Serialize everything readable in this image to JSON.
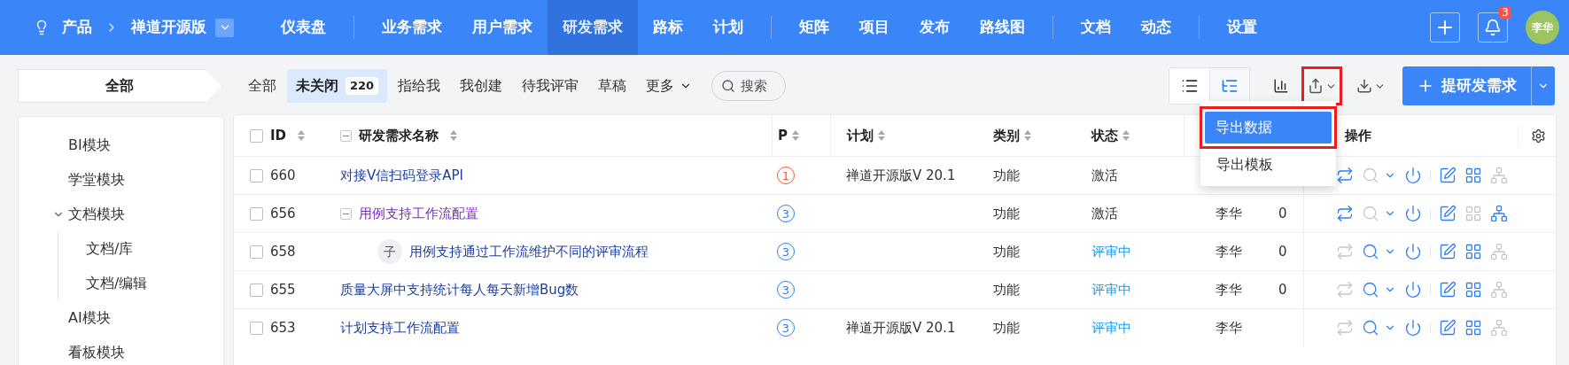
{
  "topbar": {
    "breadcrumb": [
      "产品",
      "禅道开源版"
    ],
    "nav": [
      {
        "label": "仪表盘",
        "selected": false,
        "group_end": true
      },
      {
        "label": "业务需求",
        "selected": false
      },
      {
        "label": "用户需求",
        "selected": false
      },
      {
        "label": "研发需求",
        "selected": true
      },
      {
        "label": "路标",
        "selected": false
      },
      {
        "label": "计划",
        "selected": false,
        "group_end": true
      },
      {
        "label": "矩阵",
        "selected": false
      },
      {
        "label": "项目",
        "selected": false
      },
      {
        "label": "发布",
        "selected": false
      },
      {
        "label": "路线图",
        "selected": false,
        "group_end": true
      },
      {
        "label": "文档",
        "selected": false
      },
      {
        "label": "动态",
        "selected": false,
        "group_end": true
      },
      {
        "label": "设置",
        "selected": false
      }
    ],
    "notification_count": "3",
    "avatar": "李华"
  },
  "filterbar": {
    "module": "全部",
    "tabs": [
      {
        "label": "全部",
        "selected": false
      },
      {
        "label": "未关闭",
        "count": "220",
        "selected": true
      },
      {
        "label": "指给我",
        "selected": false
      },
      {
        "label": "我创建",
        "selected": false
      },
      {
        "label": "待我评审",
        "selected": false
      },
      {
        "label": "草稿",
        "selected": false
      }
    ],
    "more": "更多",
    "search": {
      "placeholder": "搜索"
    },
    "views": [
      {
        "kind": "list",
        "selected": false
      },
      {
        "kind": "tree",
        "selected": true
      }
    ],
    "export_highlighted": true,
    "create_button": "提研发需求"
  },
  "sidebar": {
    "items": [
      {
        "label": "BI模块"
      },
      {
        "label": "学堂模块"
      },
      {
        "label": "文档模块",
        "expanded": true,
        "children": [
          {
            "label": "文档/库"
          },
          {
            "label": "文档/编辑"
          }
        ]
      },
      {
        "label": "AI模块"
      },
      {
        "label": "看板模块"
      }
    ]
  },
  "table": {
    "all_checked": false,
    "columns": [
      {
        "label": "ID"
      },
      {
        "label": "研发需求名称"
      },
      {
        "label": "P"
      },
      {
        "label": "计划"
      },
      {
        "label": "类别"
      },
      {
        "label": "状态"
      },
      {
        "label": "操作"
      }
    ],
    "rows": [
      {
        "id": "660",
        "name": "对接V信扫码登录API",
        "visited": false,
        "checked": false,
        "priority": {
          "label": "1",
          "color": "#f05a28"
        },
        "plan": "禅道开源版V 20.1",
        "type": "功能",
        "status": {
          "label": "激活",
          "color": "#333333"
        },
        "actions": [
          {
            "kind": "change",
            "disabled": false
          },
          {
            "kind": "review",
            "disabled": true
          },
          {
            "kind": "close",
            "disabled": false
          },
          {
            "kind": "edit",
            "disabled": false
          },
          {
            "kind": "batch",
            "disabled": false
          },
          {
            "kind": "split",
            "disabled": true
          }
        ]
      },
      {
        "id": "656",
        "name": "用例支持工作流配置",
        "visited": true,
        "expanded": true,
        "checked": false,
        "priority": {
          "label": "3",
          "color": "#2e7ff5"
        },
        "type": "功能",
        "status": {
          "label": "激活",
          "color": "#333333"
        },
        "assignee": "李华",
        "column_7": "0",
        "actions": [
          {
            "kind": "change",
            "disabled": false
          },
          {
            "kind": "review",
            "disabled": true
          },
          {
            "kind": "close",
            "disabled": false
          },
          {
            "kind": "edit",
            "disabled": false
          },
          {
            "kind": "batch",
            "disabled": true
          },
          {
            "kind": "split",
            "disabled": false
          }
        ],
        "children": [
          {
            "id": "658",
            "badge": "子",
            "name": "用例支持通过工作流维护不同的评审流程",
            "visited": false,
            "checked": false,
            "priority": {
              "label": "3",
              "color": "#2e7ff5"
            },
            "type": "功能",
            "status": {
              "label": "评审中",
              "color": "#1a9cf0"
            },
            "assignee": "李华",
            "column_7": "0",
            "actions": [
              {
                "kind": "change",
                "disabled": true
              },
              {
                "kind": "review",
                "disabled": false
              },
              {
                "kind": "close",
                "disabled": false
              },
              {
                "kind": "edit",
                "disabled": false
              },
              {
                "kind": "batch",
                "disabled": false
              },
              {
                "kind": "split",
                "disabled": true
              }
            ]
          }
        ]
      },
      {
        "id": "655",
        "name": "质量大屏中支持统计每人每天新增Bug数",
        "visited": false,
        "checked": false,
        "priority": {
          "label": "3",
          "color": "#2e7ff5"
        },
        "type": "功能",
        "status": {
          "label": "评审中",
          "color": "#1a9cf0"
        },
        "assignee": "李华",
        "column_7": "0",
        "actions": [
          {
            "kind": "change",
            "disabled": true
          },
          {
            "kind": "review",
            "disabled": false
          },
          {
            "kind": "close",
            "disabled": false
          },
          {
            "kind": "edit",
            "disabled": false
          },
          {
            "kind": "batch",
            "disabled": false
          },
          {
            "kind": "split",
            "disabled": true
          }
        ]
      },
      {
        "id": "653",
        "name": "计划支持工作流配置",
        "visited": false,
        "checked": false,
        "priority": {
          "label": "3",
          "color": "#2e7ff5"
        },
        "plan": "禅道开源版V 20.1",
        "type": "功能",
        "status": {
          "label": "评审中",
          "color": "#1a9cf0"
        },
        "assignee": "李华",
        "actions": [
          {
            "kind": "change",
            "disabled": true
          },
          {
            "kind": "review",
            "disabled": false
          },
          {
            "kind": "close",
            "disabled": false
          },
          {
            "kind": "edit",
            "disabled": false
          },
          {
            "kind": "batch",
            "disabled": false
          },
          {
            "kind": "split",
            "disabled": true
          }
        ]
      }
    ]
  },
  "export_menu": {
    "items": [
      {
        "label": "导出数据",
        "selected": true,
        "highlighted": true
      },
      {
        "label": "导出模板",
        "selected": false,
        "highlighted": false
      }
    ]
  }
}
